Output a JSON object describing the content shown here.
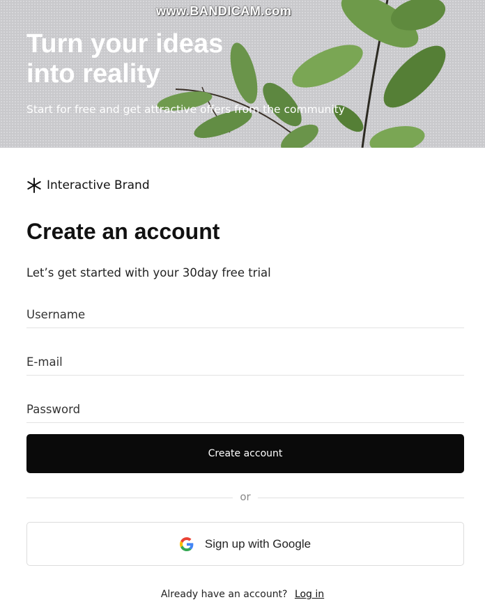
{
  "watermark": {
    "text": "www.BANDICAM.com"
  },
  "hero": {
    "title_line1": "Turn your ideas",
    "title_line2": "into reality",
    "subtitle": "Start for free and get attractive offers from the community"
  },
  "brand": {
    "name": "Interactive Brand",
    "icon": "asterisk-icon"
  },
  "form": {
    "title": "Create an account",
    "subtitle": "Let’s get started with your 30day free trial",
    "username_placeholder": "Username",
    "email_placeholder": "E-mail",
    "password_placeholder": "Password",
    "submit_label": "Create account",
    "divider_text": "or",
    "google_label": "Sign up with Google",
    "google_icon": "google-icon"
  },
  "footer": {
    "prompt": "Already have an account?",
    "login_label": "Log in"
  },
  "colors": {
    "primary_button": "#0a0a0a",
    "hero_bg": "#c9c9cc",
    "leaf": "#5f8a3e"
  }
}
